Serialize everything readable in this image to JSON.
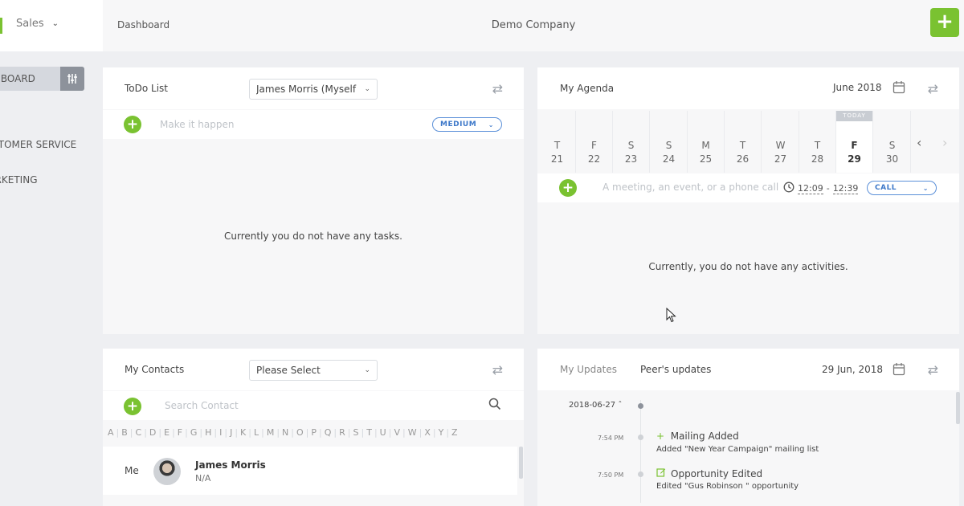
{
  "sidebar": {
    "module": "Sales",
    "dashboard_label": "DASHBOARD",
    "items": [
      "CUSTOMER SERVICE",
      "MARKETING"
    ]
  },
  "topbar": {
    "breadcrumb": "Dashboard",
    "company": "Demo Company",
    "add_label": "+"
  },
  "todo": {
    "title": "ToDo List",
    "assignee": "James Morris (Myself)",
    "placeholder": "Make it happen",
    "priority": "MEDIUM",
    "empty": "Currently you do not have any tasks."
  },
  "agenda": {
    "title": "My Agenda",
    "month": "June 2018",
    "today_tag": "TODAY",
    "days": [
      {
        "d": "T",
        "n": "21"
      },
      {
        "d": "F",
        "n": "22"
      },
      {
        "d": "S",
        "n": "23"
      },
      {
        "d": "S",
        "n": "24"
      },
      {
        "d": "M",
        "n": "25"
      },
      {
        "d": "T",
        "n": "26"
      },
      {
        "d": "W",
        "n": "27"
      },
      {
        "d": "T",
        "n": "28"
      },
      {
        "d": "F",
        "n": "29"
      },
      {
        "d": "S",
        "n": "30"
      }
    ],
    "placeholder": "A meeting, an event, or a phone call",
    "start_time": "12:09",
    "end_time": "12:39",
    "time_sep": "-",
    "type": "CALL",
    "empty": "Currently, you do not have any activities."
  },
  "contacts": {
    "title": "My Contacts",
    "select": "Please Select",
    "search_placeholder": "Search Contact",
    "letters": [
      "A",
      "B",
      "C",
      "D",
      "E",
      "F",
      "G",
      "H",
      "I",
      "J",
      "K",
      "L",
      "M",
      "N",
      "O",
      "P",
      "Q",
      "R",
      "S",
      "T",
      "U",
      "V",
      "W",
      "X",
      "Y",
      "Z"
    ],
    "row_label": "Me",
    "name": "James Morris",
    "sub": "N/A"
  },
  "updates": {
    "tab1": "My Updates",
    "tab2": "Peer's updates",
    "date": "29 Jun, 2018",
    "group_date": "2018-06-27",
    "items": [
      {
        "time": "7:54 PM",
        "title": "Mailing Added",
        "sub": "Added \"New Year Campaign\" mailing list"
      },
      {
        "time": "7:50 PM",
        "title": "Opportunity Edited",
        "sub": "Edited \"Gus Robinson \" opportunity"
      }
    ]
  }
}
